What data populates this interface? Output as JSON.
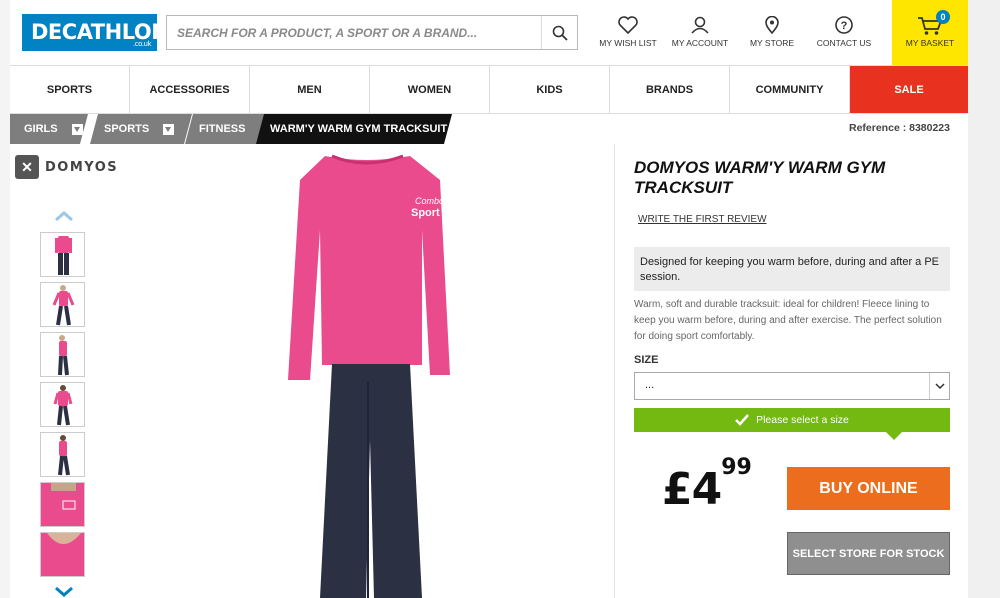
{
  "header": {
    "logo_text": "DECATHLON",
    "logo_domain": ".co.uk",
    "search_placeholder": "SEARCH FOR A PRODUCT, A SPORT OR A BRAND...",
    "links": {
      "wishlist": "MY WISH LIST",
      "account": "MY ACCOUNT",
      "store": "MY STORE",
      "contact": "CONTACT US",
      "basket": "MY BASKET"
    },
    "basket_count": "0"
  },
  "nav": {
    "items": [
      "SPORTS",
      "ACCESSORIES",
      "MEN",
      "WOMEN",
      "KIDS",
      "BRANDS",
      "COMMUNITY",
      "SALE"
    ]
  },
  "breadcrumb": {
    "items": [
      "GIRLS",
      "SPORTS",
      "FITNESS",
      "WARM'Y WARM GYM TRACKSUIT"
    ]
  },
  "reference": "Reference : 8380223",
  "brand": "DOMYOS",
  "product": {
    "title": "DOMYOS WARM'Y WARM GYM TRACKSUIT",
    "review_link": "WRITE THE FIRST REVIEW",
    "short_description": "Designed for keeping you warm before, during and after a PE session.",
    "long_description": "Warm, soft and durable tracksuit: ideal for children! Fleece lining to keep you warm before, during and after exercise. The perfect solution for doing sport comfortably.",
    "size_label": "SIZE",
    "size_value": "...",
    "size_notice": "Please select a size",
    "price_main": "£4",
    "price_pence": "99",
    "buy_label": "BUY ONLINE",
    "store_label": "SELECT STORE FOR STOCK"
  },
  "colors": {
    "brand_blue": "#0082c3",
    "basket_yellow": "#ffe600",
    "sale_red": "#e8321f",
    "buy_orange": "#ec6d1d",
    "notice_green": "#74b911",
    "sweatshirt_pink": "#e94b8c",
    "pants_navy": "#2b3042"
  }
}
